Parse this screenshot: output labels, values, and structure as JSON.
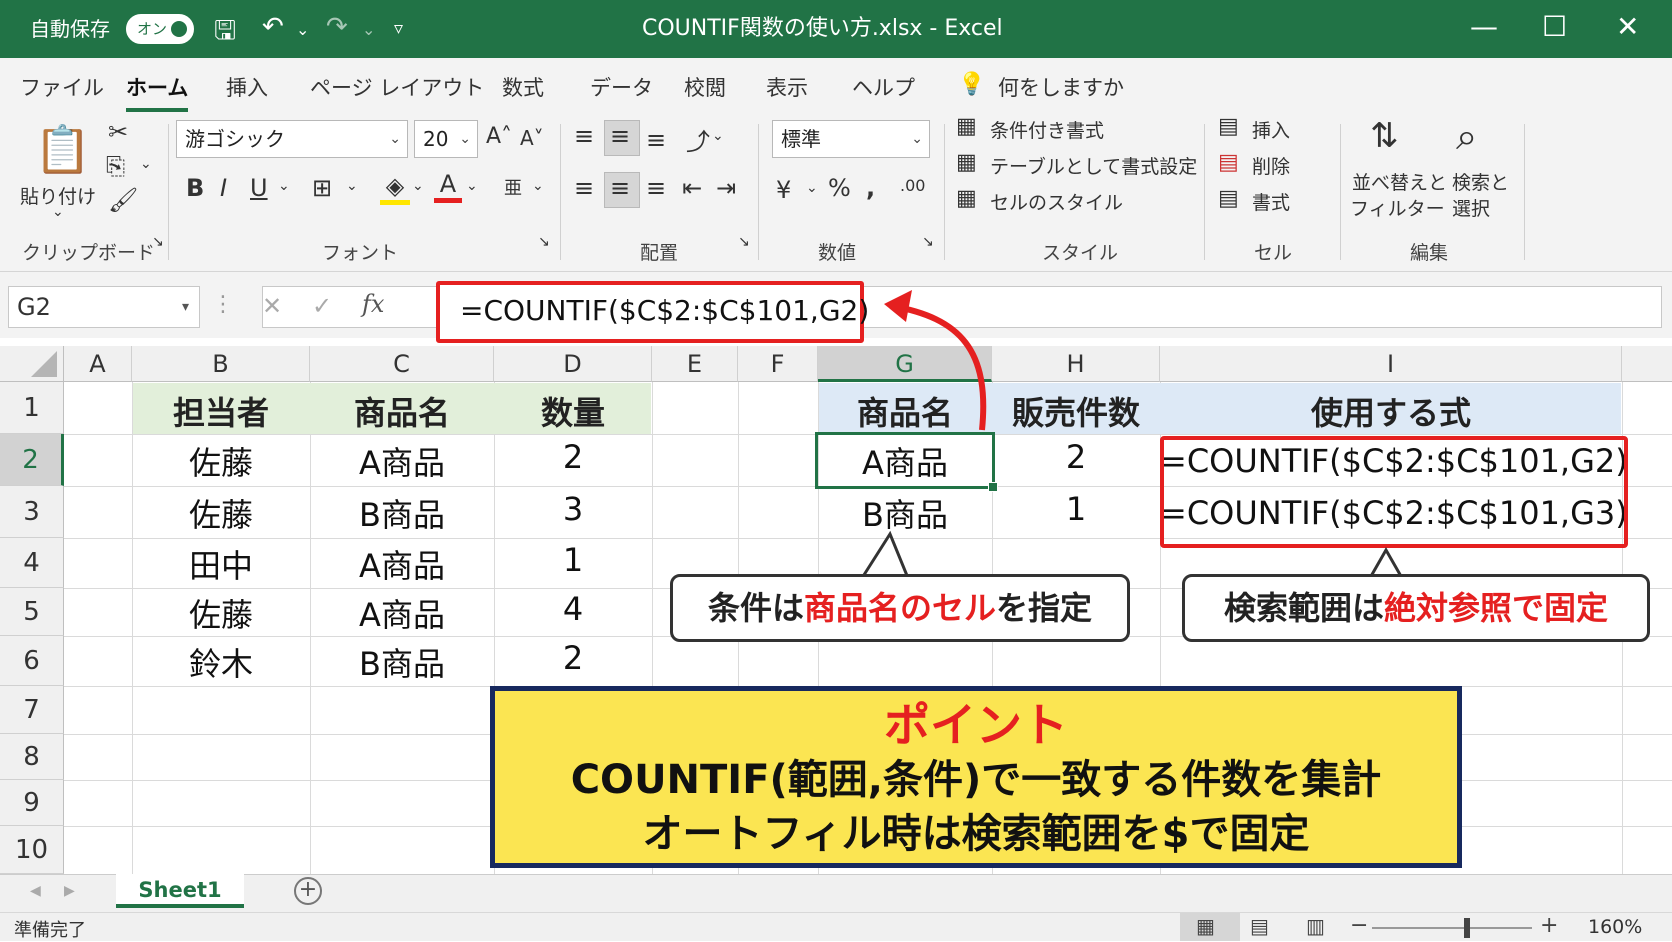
{
  "titlebar": {
    "autosave_label": "自動保存",
    "toggle_label": "オン",
    "title": "COUNTIF関数の使い方.xlsx  -  Excel"
  },
  "menu": {
    "items": [
      "ファイル",
      "ホーム",
      "挿入",
      "ページ レイアウト",
      "数式",
      "データ",
      "校閲",
      "表示",
      "ヘルプ"
    ],
    "search": "何をしますか"
  },
  "ribbon": {
    "paste": "貼り付け",
    "font_name": "游ゴシック",
    "font_size": "20",
    "number_format": "標準",
    "groups": [
      "クリップボード",
      "フォント",
      "配置",
      "数値",
      "スタイル",
      "セル",
      "編集"
    ],
    "styles": [
      "条件付き書式",
      "テーブルとして書式設定",
      "セルのスタイル"
    ],
    "cells": [
      "挿入",
      "削除",
      "書式"
    ],
    "sort_filter": [
      "並べ替えと",
      "フィルター"
    ],
    "find_select": [
      "検索と",
      "選択"
    ]
  },
  "formula_bar": {
    "name_box": "G2",
    "formula": "=COUNTIF($C$2:$C$101,G2)"
  },
  "sheet": {
    "columns": [
      "A",
      "B",
      "C",
      "D",
      "E",
      "F",
      "G",
      "H",
      "I"
    ],
    "rows": [
      "1",
      "2",
      "3",
      "4",
      "5",
      "6",
      "7",
      "8",
      "9",
      "10"
    ],
    "left_headers": [
      "担当者",
      "商品名",
      "数量"
    ],
    "left_rows": [
      [
        "佐藤",
        "A商品",
        "2"
      ],
      [
        "佐藤",
        "B商品",
        "3"
      ],
      [
        "田中",
        "A商品",
        "1"
      ],
      [
        "佐藤",
        "A商品",
        "4"
      ],
      [
        "鈴木",
        "B商品",
        "2"
      ]
    ],
    "right_headers": [
      "商品名",
      "販売件数",
      "使用する式"
    ],
    "right_rows": [
      [
        "A商品",
        "2",
        "=COUNTIF($C$2:$C$101,G2)"
      ],
      [
        "B商品",
        "1",
        "=COUNTIF($C$2:$C$101,G3)"
      ]
    ]
  },
  "callouts": {
    "left_prefix": "条件は",
    "left_highlight": "商品名のセル",
    "left_suffix": "を指定",
    "right_prefix": "検索範囲は",
    "right_highlight": "絶対参照で固定"
  },
  "point": {
    "heading": "ポイント",
    "line1": "COUNTIF(範囲,条件)で一致する件数を集計",
    "line2": "オートフィル時は検索範囲を$で固定"
  },
  "sheet_tab": "Sheet1",
  "status": {
    "ready": "準備完了",
    "zoom": "160%"
  },
  "colors": {
    "excel_green": "#217346",
    "highlight_red": "#e52020",
    "point_yellow": "#fbe552",
    "left_header_bg": "#e2efda",
    "right_header_bg": "#dde9f6"
  }
}
